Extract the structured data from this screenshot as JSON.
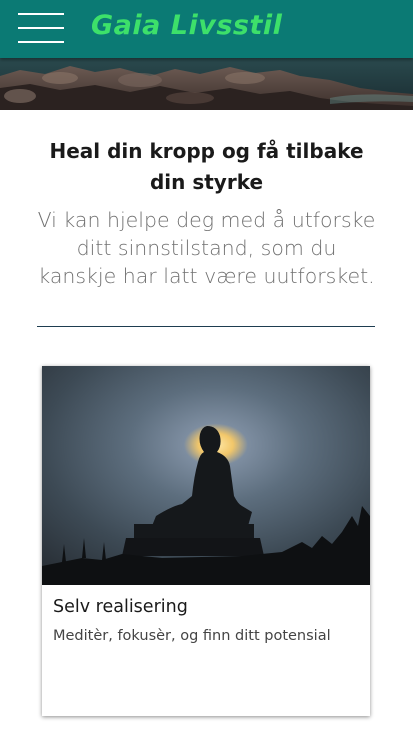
{
  "header": {
    "brand": "Gaia Livsstil",
    "menu_icon": "hamburger-menu-icon",
    "background_color": "#0b7a74",
    "brand_color": "#3de06a"
  },
  "hero": {
    "image": "rocky-coastline-photo"
  },
  "main": {
    "headline": "Heal din kropp og få tilbake din styrke",
    "subtext": "Vi kan hjelpe deg med å utforske ditt sinnstilstand, som du kanskje har latt være uutforsket."
  },
  "cards": [
    {
      "image": "buddha-statue-silhouette-photo",
      "title": "Selv realisering",
      "description": "Meditèr, fokusèr, og finn ditt potensial"
    }
  ]
}
